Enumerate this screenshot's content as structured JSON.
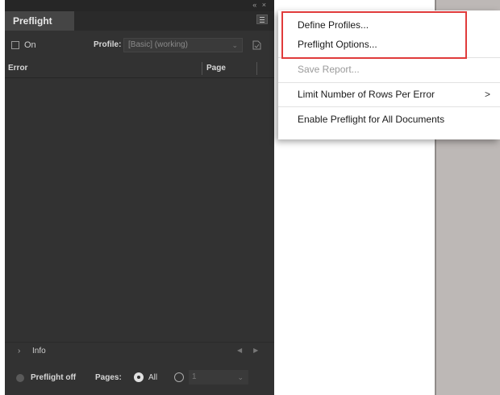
{
  "panel": {
    "tab_title": "Preflight",
    "collapse_controls": "« ×",
    "on_label": "On",
    "profile_label": "Profile:",
    "profile_value": "[Basic] (working)",
    "columns": {
      "error": "Error",
      "page": "Page"
    },
    "info_label": "Info",
    "status_text": "Preflight off",
    "pages_label": "Pages:",
    "all_label": "All",
    "page_range_value": "1"
  },
  "flyout": {
    "items": [
      {
        "label": "Define Profiles...",
        "enabled": true
      },
      {
        "label": "Preflight Options...",
        "enabled": true
      },
      {
        "label": "Save Report...",
        "enabled": false
      },
      {
        "label": "Limit Number of Rows Per Error",
        "enabled": true,
        "submenu": true
      },
      {
        "label": "Enable Preflight for All Documents",
        "enabled": true
      }
    ],
    "submenu_arrow": ">"
  },
  "colors": {
    "panel_bg": "#323232",
    "highlight": "#e03b3b",
    "doc_strip": "#bdb8b6"
  }
}
